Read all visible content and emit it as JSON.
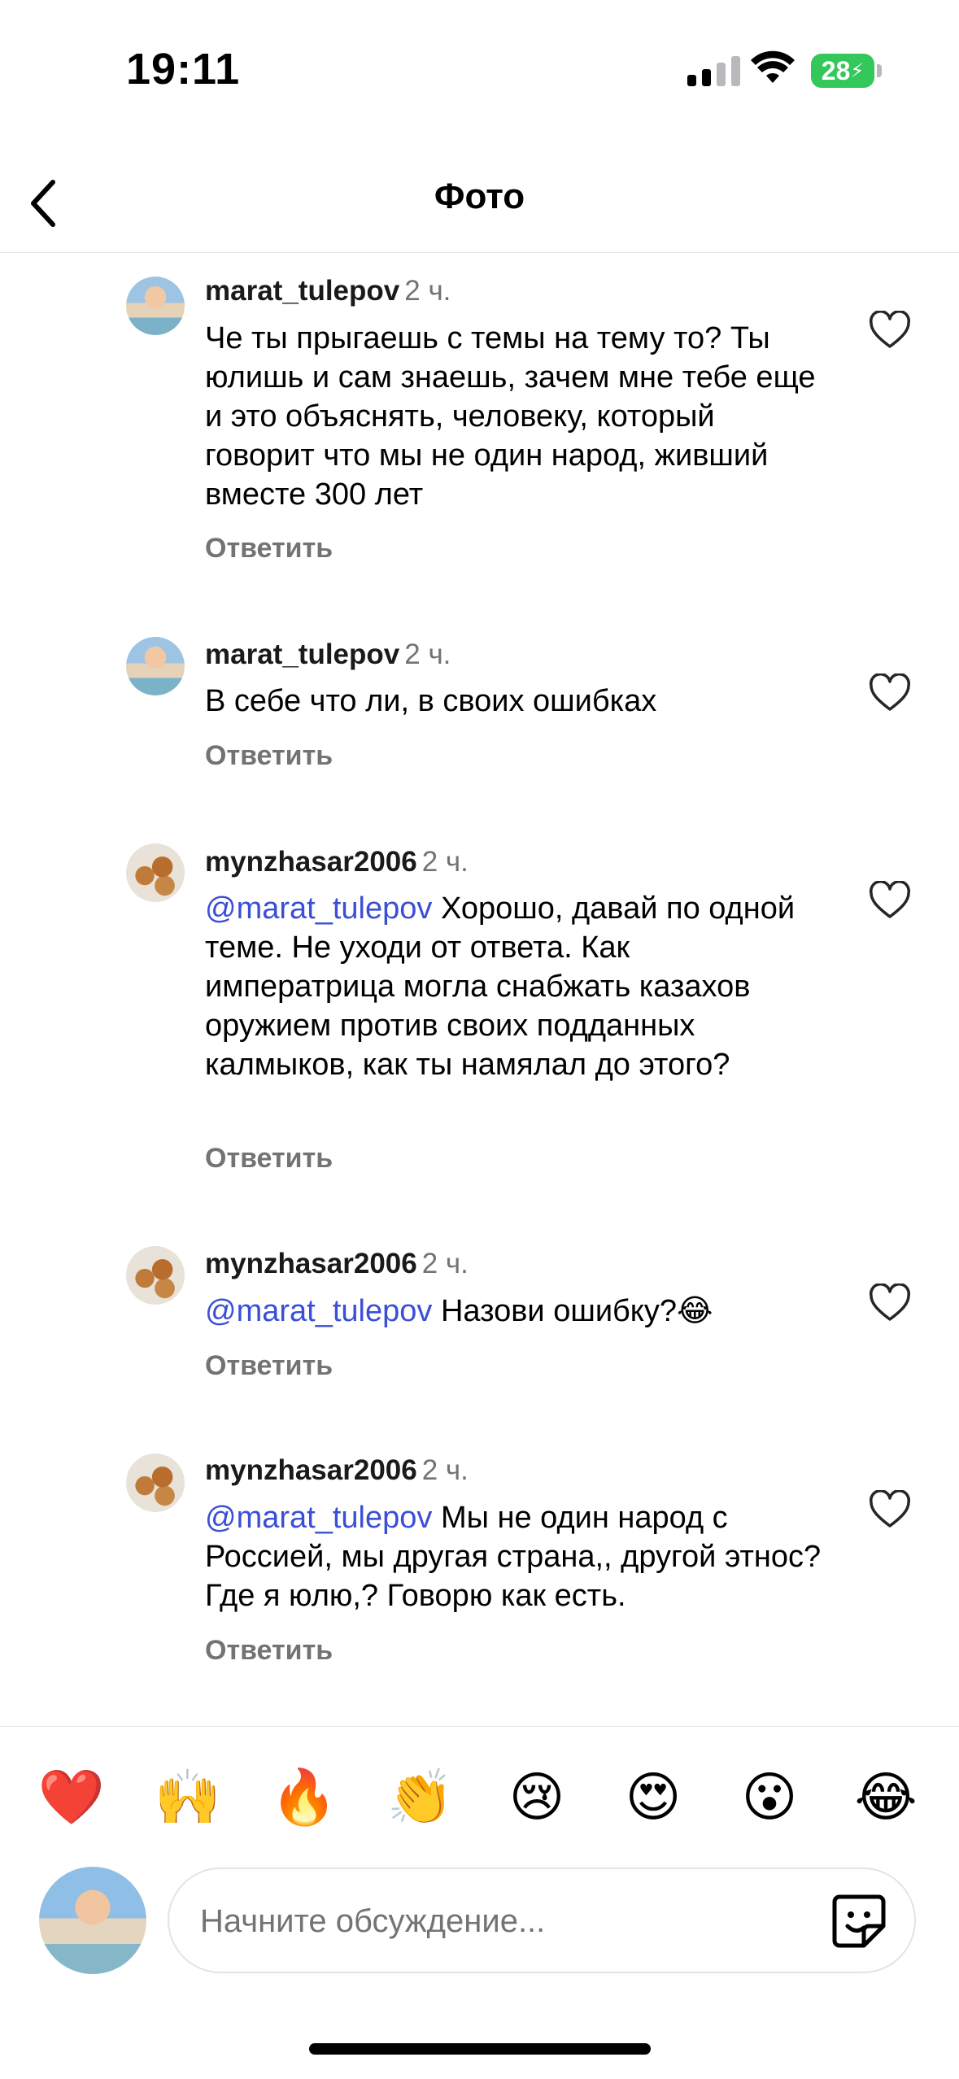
{
  "status": {
    "time": "19:11",
    "battery": "28"
  },
  "header": {
    "title": "Фото"
  },
  "comments": [
    {
      "user": "marat_tulepov",
      "time": "2 ч.",
      "mention": "",
      "text": "Че ты прыгаешь с темы на тему то? Ты юлишь и сам знаешь, зачем мне тебе еще и это объяснять, человеку, который говорит что мы не один народ, живший вместе 300 лет",
      "reply": "Ответить"
    },
    {
      "user": "marat_tulepov",
      "time": "2 ч.",
      "mention": "",
      "text": "В себе что ли, в своих ошибках",
      "reply": "Ответить"
    },
    {
      "user": "mynzhasar2006",
      "time": "2 ч.",
      "mention": "@marat_tulepov",
      "text": " Хорошо, давай по одной теме. Не уходи от ответа. Как императрица могла снабжать казахов оружием против своих подданных калмыков, как ты намялал до этого?",
      "reply": "Ответить"
    },
    {
      "user": "mynzhasar2006",
      "time": "2 ч.",
      "mention": "@marat_tulepov",
      "text": " Назови ошибку?😂",
      "reply": "Ответить"
    },
    {
      "user": "mynzhasar2006",
      "time": "2 ч.",
      "mention": "@marat_tulepov",
      "text": " Мы не один народ с Россией, мы другая страна,, другой этнос? Где я юлю,? Говорю как есть.",
      "reply": "Ответить"
    }
  ],
  "reactions": [
    "❤️",
    "🙌",
    "🔥",
    "👏",
    "😢",
    "😍",
    "😮",
    "😂"
  ],
  "composer": {
    "placeholder": "Начните обсуждение..."
  },
  "colors": {
    "mention": "#3a4fd6",
    "meta": "#737373",
    "battery": "#34c759"
  }
}
